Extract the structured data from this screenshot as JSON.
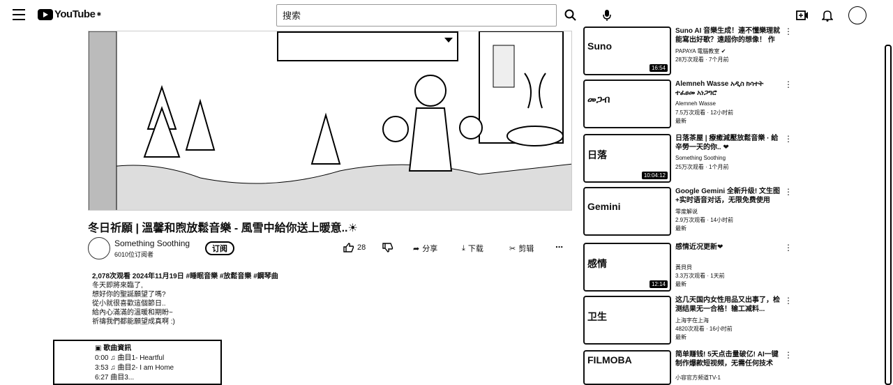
{
  "header": {
    "logo_text": "YouTube",
    "logo_sup": "✱",
    "search_placeholder": "搜索"
  },
  "video": {
    "title": "冬日祈願 | 溫馨和煦放鬆音樂 - 風雪中給你送上暖意..☀",
    "channel_name": "Something Soothing",
    "subscribers": "6010位订阅者",
    "subscribe_label": "订阅",
    "like_count": "28",
    "share_label": "分享",
    "download_label": "下载",
    "clip_label": "剪辑"
  },
  "description": {
    "meta": "2,078次观看  2024年11月19日  #睡眠音樂 #放鬆音樂 #鋼琴曲",
    "lines": [
      "冬天即將來臨了,",
      "想好你的聖誕願望了嗎?",
      "從小就很喜歡這個節日..",
      "給內心滿滿的溫暖和期盼~",
      "祈禱我們都能願望成真啊 :)"
    ]
  },
  "songs": {
    "heading": "歌曲資訊",
    "items": [
      "0:00 ♫ 曲目1- Heartful",
      "3:53 ♫ 曲目2- I am Home",
      "6:27 曲目3..."
    ]
  },
  "sidebar": [
    {
      "thumb_text": "Suno",
      "duration": "16:54",
      "title": "Suno AI 音樂生成！連不懂樂理就能寫出好歌？遠超你的想像！ 作曲全自動化",
      "channel": "PAPAYA 電腦教室 ✔",
      "views": "28万次观看 · 7个月前",
      "new": ""
    },
    {
      "thumb_text": "መጋብ",
      "duration": "",
      "title": "Alemneh Wasse አዲስ ክሳተት ተፈፀመ አነጋግሮ",
      "channel": "Alemneh Wasse",
      "views": "7.5万次观看 · 12小时前",
      "new": "最新"
    },
    {
      "thumb_text": "日落",
      "duration": "10:04:12",
      "title": "日落茶屋 | 療癒減壓放鬆音樂 · 給辛勞一天的你.. ❤",
      "channel": "Something Soothing",
      "views": "25万次观看 · 1个月前",
      "new": ""
    },
    {
      "thumb_text": "Gemini",
      "duration": "",
      "title": "Google Gemini 全新升级! 文生图+实时语音对话，无限免费使用",
      "channel": "零度解说",
      "views": "2.9万次观看 · 14小时前",
      "new": "最新"
    },
    {
      "thumb_text": "感情",
      "duration": "12:14",
      "title": "感情近况更新❤",
      "channel": "黃貝貝",
      "views": "3.3万次观看 · 1天前",
      "new": "最新"
    },
    {
      "thumb_text": "卫生",
      "duration": "",
      "title": "这几天国内女性用品又出事了，检测结果无一合格！输工减料...",
      "channel": "上海字在上海",
      "views": "4820次观看 · 16小时前",
      "new": "最新"
    },
    {
      "thumb_text": "FILMOBA",
      "duration": "",
      "title": "简单赚钱! 5天点击量破亿! AI一键制作爆款短视频，无需任何技术",
      "channel": "小容官方频道TV-1",
      "views": "",
      "new": ""
    }
  ]
}
